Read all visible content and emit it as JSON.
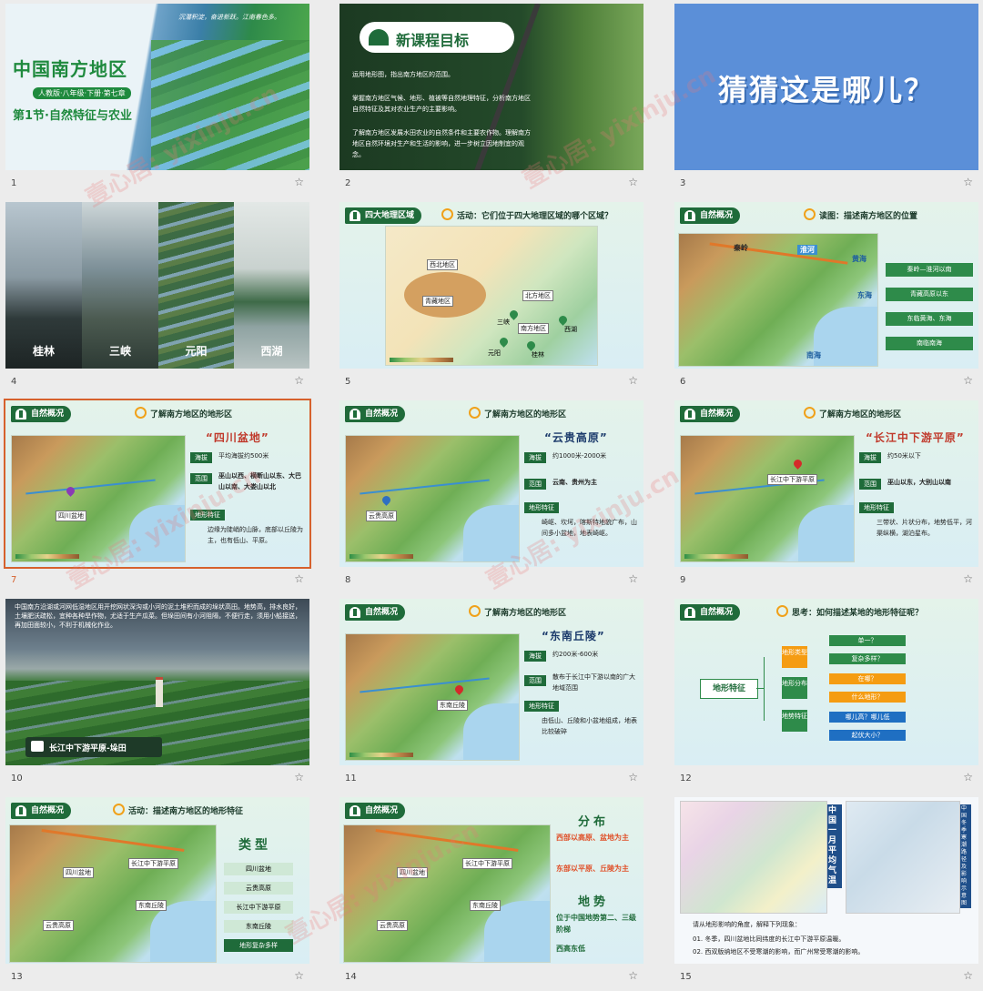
{
  "slides": [
    {
      "num": "1",
      "title": "中国南方地区",
      "subtitle": "人教版·八年级·下册·第七章",
      "section": "第1节·自然特征与农业",
      "motto": "沉潜积淀，奋进新跃。江南春色多。"
    },
    {
      "num": "2",
      "heading": "新课程目标",
      "goals": [
        "运用地形图，指出南方地区的范围。",
        "掌握南方地区气候、地形、植被等自然地理特征，分析南方地区自然特征及其对农业生产的主要影响。",
        "了解南方地区发展水田农业的自然条件和主要农作物。理解南方地区自然环境对生产和生活的影响，进一步树立因地制宜的观念。"
      ]
    },
    {
      "num": "3",
      "question": "猜猜这是哪儿？"
    },
    {
      "num": "4",
      "places": [
        "桂林",
        "三峡",
        "元阳",
        "西湖"
      ]
    },
    {
      "num": "5",
      "header": "四大地理区域",
      "activity": "活动：它们位于四大地理区域的哪个区域？",
      "regions": [
        "西北地区",
        "北方地区",
        "青藏地区",
        "南方地区"
      ],
      "places": [
        "三峡",
        "元阳",
        "桂林",
        "西湖"
      ]
    },
    {
      "num": "6",
      "header": "自然概况",
      "activity": "读图：描述南方地区的位置",
      "map_labels": [
        "秦岭",
        "淮河",
        "黄海",
        "东海",
        "南海"
      ],
      "buttons": [
        "秦岭—淮河以南",
        "青藏高原以东",
        "东临黄海、东海",
        "南临南海"
      ]
    },
    {
      "num": "7",
      "header": "自然概况",
      "activity": "了解南方地区的地形区",
      "landform": "“四川盆地”",
      "tags": [
        "海拔",
        "范围",
        "地形特征"
      ],
      "altitude": "平均海拔约500米",
      "range": "巫山以西、横断山以东、大巴山以南、大娄山以北",
      "feature": "边缘为陡峭的山脉，底部以丘陵为主，也有低山、平原。",
      "pin_label": "四川盆地"
    },
    {
      "num": "8",
      "header": "自然概况",
      "activity": "了解南方地区的地形区",
      "landform": "“云贵高原”",
      "tags": [
        "海拔",
        "范围",
        "地形特征"
      ],
      "altitude": "约1000米-2000米",
      "range": "云南、贵州为主",
      "feature": "崎岖、坎坷，喀斯特地貌广布，山间多小盆地，地表崎岖。",
      "pin_label": "云贵高原"
    },
    {
      "num": "9",
      "header": "自然概况",
      "activity": "了解南方地区的地形区",
      "landform": "“长江中下游平原”",
      "tags": [
        "海拔",
        "范围",
        "地形特征"
      ],
      "altitude": "约50米以下",
      "range": "巫山以东，大别山以南",
      "feature": "三带状、片状分布，地势低平，河渠纵横，湖泊星布。",
      "pin_label": "长江中下游平原"
    },
    {
      "num": "10",
      "paragraph": "中国南方沿湖或河网低湿地区用开挖网状深沟或小河的泥土堆积而成的垛状高田。地势高，排水良好，土壤肥沃疏松，宜种各种旱作物，尤适于生产瓜菜。但垛田间有小河阻隔，不便行走，须用小船接送，再加田面较小，不利于机械化作业。",
      "caption": "长江中下游平原-垛田"
    },
    {
      "num": "11",
      "header": "自然概况",
      "activity": "了解南方地区的地形区",
      "landform": "“东南丘陵”",
      "tags": [
        "海拔",
        "范围",
        "地形特征"
      ],
      "altitude": "约200米-600米",
      "range": "散布于长江中下游以南的广大地域范围",
      "feature": "由低山、丘陵和小盆地组成，地表比较破碎",
      "pin_label": "东南丘陵"
    },
    {
      "num": "12",
      "header": "自然概况",
      "activity": "思考：如何描述某地的地形特征呢？",
      "root": "地形特征",
      "branches": [
        {
          "label": "地形类型",
          "items": [
            "单一？",
            "复杂多样？"
          ]
        },
        {
          "label": "地形分布",
          "items": [
            "在哪？",
            "什么地形？"
          ]
        },
        {
          "label": "地势特征",
          "items": [
            "哪儿高？哪儿低",
            "起伏大小？"
          ]
        }
      ]
    },
    {
      "num": "13",
      "header": "自然概况",
      "activity": "活动：描述南方地区的地形特征",
      "type_title": "类型",
      "types": [
        "四川盆地",
        "云贵高原",
        "长江中下游平原",
        "东南丘陵",
        "地形复杂多样"
      ],
      "map_labels": [
        "四川盆地",
        "长江中下游平原",
        "云贵高原",
        "东南丘陵"
      ]
    },
    {
      "num": "14",
      "header": "自然概况",
      "dist_title": "分布",
      "dist_items": [
        "西部以高原、盆地为主",
        "东部以平原、丘陵为主"
      ],
      "trend_title": "地势",
      "trend_items": [
        "位于中国地势第二、三级阶梯",
        "西高东低"
      ],
      "map_labels": [
        "四川盆地",
        "长江中下游平原",
        "云贵高原",
        "东南丘陵"
      ]
    },
    {
      "num": "15",
      "map_title_left": "中国一月平均气温",
      "map_title_right": "中国冬季寒潮路径及影响示意图",
      "prompt": "请从地形影响的角度，解释下列现象：",
      "items": [
        "01. 冬季，四川盆地比同纬度的长江中下游平原温暖。",
        "02. 西双版纳地区不受寒潮的影响，而广州常受寒潮的影响。"
      ]
    }
  ],
  "watermark": "壹心居: yixinju.cn",
  "colors": {
    "accent": "#1f6b3a",
    "selection": "#d6612d",
    "title_blue": "#1b3a6b"
  }
}
